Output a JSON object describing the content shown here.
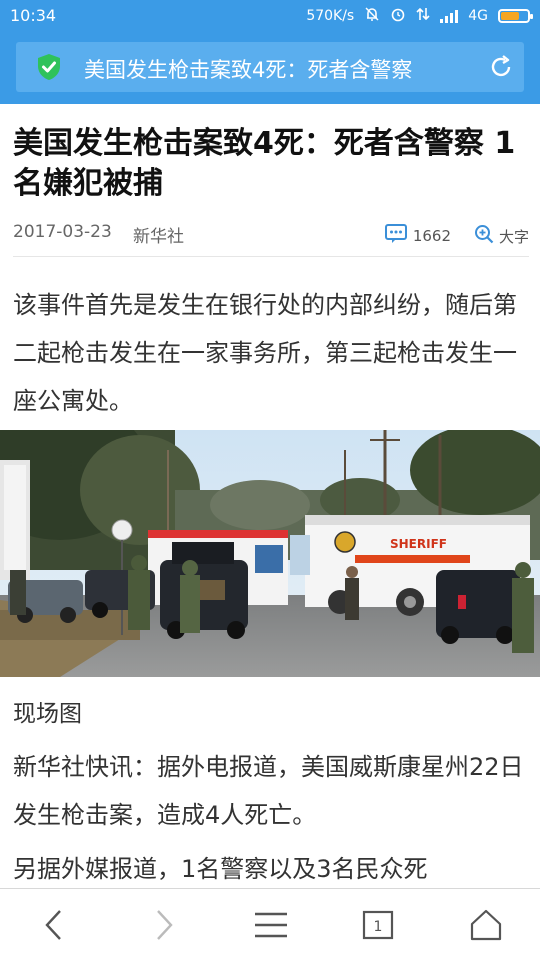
{
  "status_bar": {
    "time": "10:34",
    "speed": "570K/s",
    "network": "4G",
    "battery_color": "#f5a623",
    "battery_fraction": 0.75,
    "icons": [
      "notification-icon",
      "alarm-icon",
      "data-icon",
      "signal-icon",
      "battery-icon"
    ]
  },
  "header": {
    "title": "美国发生枪击案致4死：死者含警察",
    "accent": "#3b9be6",
    "security_icon": "shield-check-icon",
    "refresh_icon": "refresh-icon"
  },
  "article": {
    "title": "美国发生枪击案致4死：死者含警察 1名嫌犯被捕",
    "date": "2017-03-23",
    "source": "新华社",
    "comment_count": "1662",
    "font_size_label": "大字",
    "lead": "该事件首先是发生在银行处的内部纠纷，随后第二起枪击发生在一家事务所，第三起枪击发生一座公寓处。",
    "image_caption": "现场图",
    "paragraph_2": "新华社快讯：据外电报道，美国威斯康星州22日发生枪击案，造成4人死亡。",
    "paragraph_3": "另据外媒报道，1名警察以及3名民众死",
    "photo_vehicle_text": "SHERIFF"
  },
  "bottom_nav": {
    "tab_count": "1",
    "items": [
      "back-icon",
      "forward-icon",
      "menu-icon",
      "tabs-icon",
      "home-icon"
    ]
  }
}
